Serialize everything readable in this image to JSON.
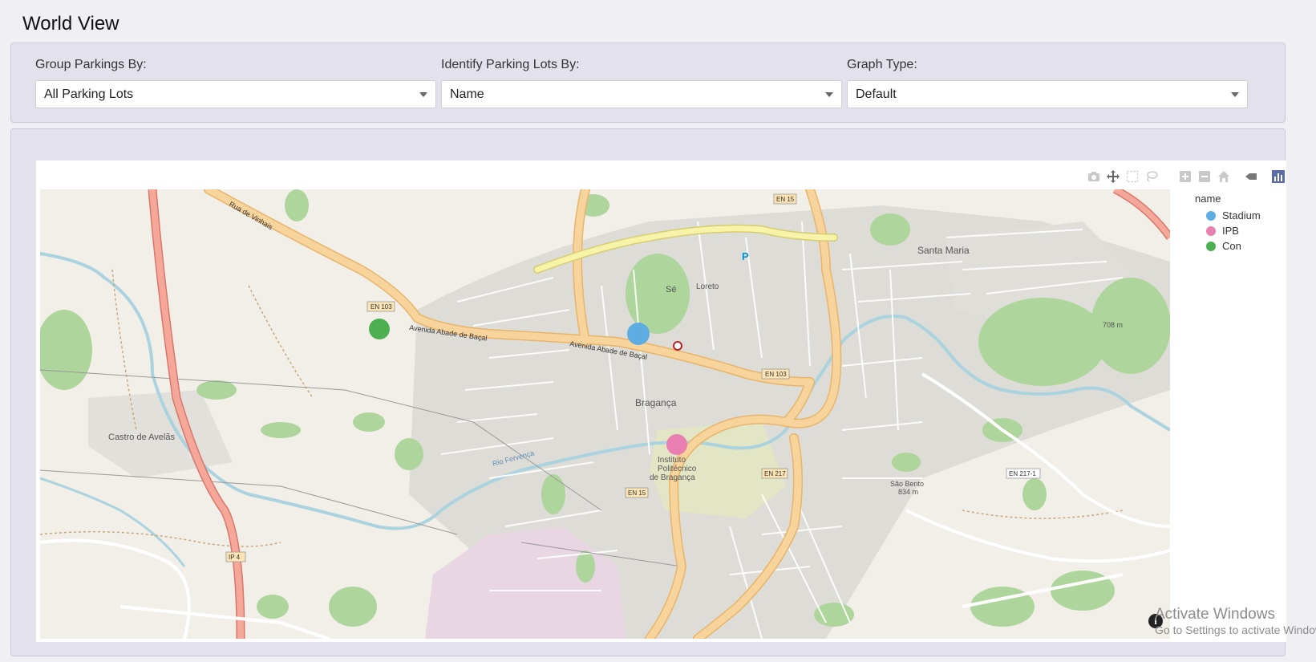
{
  "page": {
    "title": "World View"
  },
  "filters": [
    {
      "label": "Group Parkings By:",
      "value": "All Parking Lots"
    },
    {
      "label": "Identify Parking Lots By:",
      "value": "Name"
    },
    {
      "label": "Graph Type:",
      "value": "Default"
    }
  ],
  "modebar": {
    "icons": [
      "camera-icon",
      "pan-icon",
      "box-select-icon",
      "lasso-select-icon",
      "zoom-in-icon",
      "zoom-out-icon",
      "reset-view-icon",
      "toggle-hover-icon",
      "plotly-logo-icon"
    ]
  },
  "legend": {
    "title": "name",
    "items": [
      {
        "label": "Stadium",
        "color": "#5dade2"
      },
      {
        "label": "IPB",
        "color": "#e87fb0"
      },
      {
        "label": "Con",
        "color": "#4cb050"
      }
    ]
  },
  "map": {
    "labels": {
      "castro_de_avelas": "Castro de Avelãs",
      "braganca": "Bragança",
      "se": "Sé",
      "loreto": "Loreto",
      "santa_maria": "Santa Maria",
      "ipb": [
        "Instituto",
        "Politécnico",
        "de Bragança"
      ],
      "sao_bento": "São Bento",
      "sao_bento_alt": "834 m",
      "alt_708": "708 m",
      "en103": "EN 103",
      "en103b": "EN 103",
      "en15": "EN 15",
      "en15b": "EN 15",
      "en217": "EN 217",
      "en2171": "EN 217-1",
      "ip4": "IP 4",
      "av_abade": "Avenida Abade de Baçal",
      "av_abade2": "Avenida Abade de Baçal",
      "r_fervenca": "Rio Fervença",
      "r_vinhais": "Rua de Vinhais",
      "parking": "P"
    },
    "points": [
      {
        "name": "Con",
        "color": "#4cb050"
      },
      {
        "name": "Stadium",
        "color": "#5dade2"
      },
      {
        "name": "IPB",
        "color": "#e87fb0"
      }
    ]
  },
  "watermark": {
    "line1": "Activate Windows",
    "line2": "Go to Settings to activate Windows."
  }
}
